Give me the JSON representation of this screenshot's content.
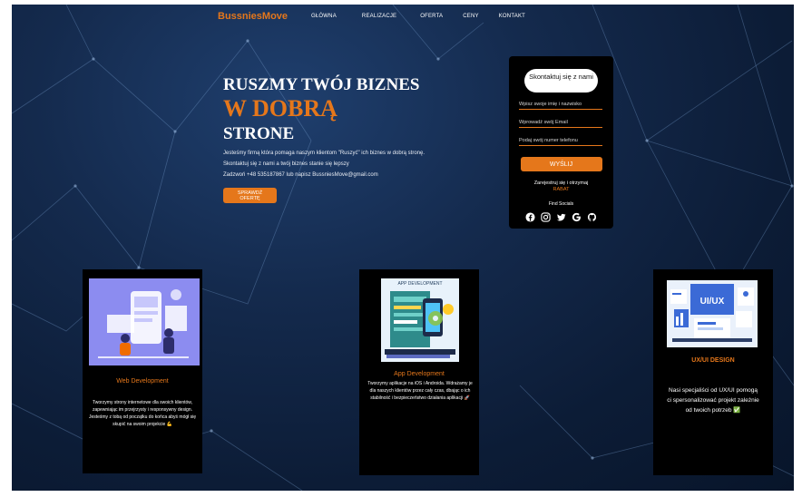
{
  "brand": {
    "name": "BussniesMove",
    "color": "#e5771b"
  },
  "nav": {
    "links": [
      {
        "label": "Główna"
      },
      {
        "label": "Realizacje"
      },
      {
        "label": "Oferta"
      },
      {
        "label": "Ceny"
      },
      {
        "label": "Kontakt"
      }
    ]
  },
  "hero": {
    "line1": "RUSZMY TWÓJ BIZNES",
    "line2": "W DOBRĄ",
    "line3": "STRONE",
    "p1": "Jesteśmy firmą która pomaga naszym klientom \"Ruszyć\" ich biznes w dobrą stronę.",
    "p2": "Skontaktuj się z nami a twój biznes stanie się lepszy",
    "p3": "Zadzwoń +48 535187867 lub napisz BussniesMove@gmail.com",
    "cta": "Sprawdź ofertę"
  },
  "contact": {
    "title": "Skontaktuj się z nami",
    "name_placeholder": "Wpisz swoje imię i nazwisko",
    "email_placeholder": "Wprowadź swój Email",
    "phone_placeholder": "Podaj swój numer telefonu",
    "send": "WYŚLIJ",
    "note": "Zarejestruj się i otrzymaj",
    "note_highlight": "RABAT",
    "follow": "Find Socials",
    "socials": [
      "facebook-icon",
      "instagram-icon",
      "twitter-icon",
      "google-icon",
      "github-icon"
    ]
  },
  "cards": [
    {
      "title": "Web Development",
      "desc": "Tworzymy strony internetowe dla swoich klientów, zapewniając im przejrzysty i responsywny design. Jesteśmy z tobą od początku do końca abyś mógł się skupić na swoim projekcie 💪"
    },
    {
      "image_label": "APP DEVELOPMENT",
      "title": "App Development",
      "desc": "Tworzymy aplikacje na iOS i Androida. Wdrażamy je dla naszych klientów przez cały czas, dbając o ich stabilność i bezpieczeństwo działania aplikacji 🚀"
    },
    {
      "image_label": "UI/UX",
      "title": "UX/UI DESIGN",
      "desc": "Nasi specjaliści od UX/UI pomogą ci spersonalizować projekt zależnie od twoich potrzeb ✅"
    }
  ],
  "colors": {
    "accent": "#e5771b",
    "background": "#142a4d",
    "panel": "#000000"
  }
}
